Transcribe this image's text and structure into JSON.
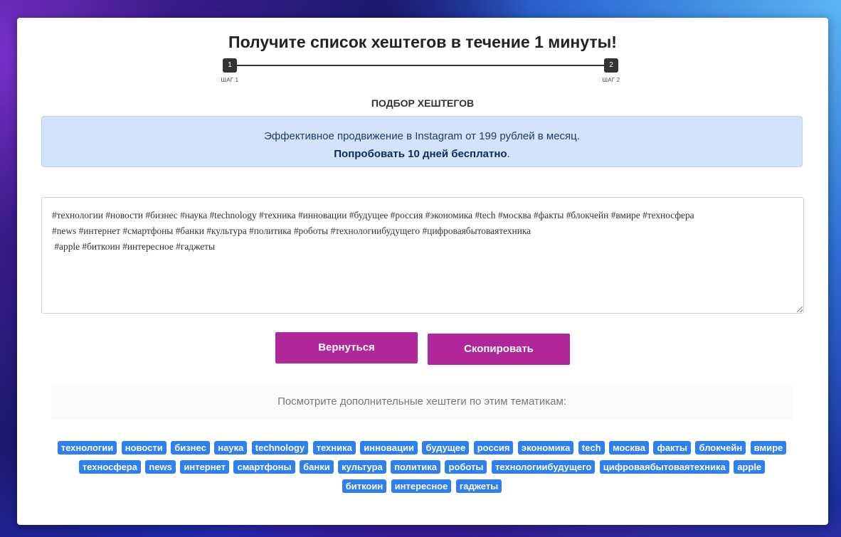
{
  "header": {
    "title": "Получите список хештегов в течение 1 минуты!"
  },
  "stepper": {
    "steps": [
      {
        "number": "1",
        "label": "ШАГ 1"
      },
      {
        "number": "2",
        "label": "ШАГ 2"
      }
    ]
  },
  "section": {
    "heading": "ПОДБОР ХЕШТЕГОВ"
  },
  "promo": {
    "line1": "Эффективное продвижение в Instagram от 199 рублей в месяц.",
    "link": "Попробовать 10 дней бесплатно",
    "suffix": "."
  },
  "result": {
    "text": "#технологии #новости #бизнес #наука #technology #техника #инновации #будущее #россия #экономика #tech #москва #факты #блокчейн #вмире #техносфера\n#news #интернет #смартфоны #банки #культура #политика #роботы #технологиибудущего #цифроваябытоваятехника\n #apple #биткоин #интересное #гаджеты"
  },
  "buttons": {
    "back": "Вернуться",
    "copy": "Скопировать"
  },
  "more": {
    "text": "Посмотрите дополнительные хештеги по этим тематикам:"
  },
  "tags": [
    "технологии",
    "новости",
    "бизнес",
    "наука",
    "technology",
    "техника",
    "инновации",
    "будущее",
    "россия",
    "экономика",
    "tech",
    "москва",
    "факты",
    "блокчейн",
    "вмире",
    "техносфера",
    "news",
    "интернет",
    "смартфоны",
    "банки",
    "культура",
    "политика",
    "роботы",
    "технологиибудущего",
    "цифроваябытоваятехника",
    "apple",
    "биткоин",
    "интересное",
    "гаджеты"
  ],
  "colors": {
    "button": "#b0279a",
    "tag": "#2f7ff0",
    "promo_bg": "#d3e3fc"
  }
}
